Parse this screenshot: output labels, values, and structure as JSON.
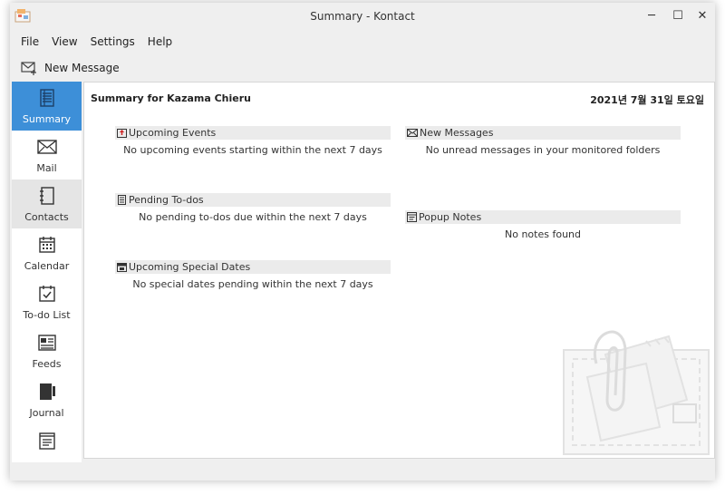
{
  "window": {
    "title": "Summary - Kontact",
    "controls": {
      "minimize": "─",
      "maximize": "☐",
      "close": "✕"
    }
  },
  "menu": [
    "File",
    "View",
    "Settings",
    "Help"
  ],
  "toolbar": {
    "new_message": "New Message"
  },
  "sidebar": {
    "items": [
      {
        "label": "Summary",
        "icon": "summary-icon",
        "active": true
      },
      {
        "label": "Mail",
        "icon": "mail-icon"
      },
      {
        "label": "Contacts",
        "icon": "contacts-icon"
      },
      {
        "label": "Calendar",
        "icon": "calendar-icon"
      },
      {
        "label": "To-do List",
        "icon": "todo-icon"
      },
      {
        "label": "Feeds",
        "icon": "feeds-icon"
      },
      {
        "label": "Journal",
        "icon": "journal-icon"
      },
      {
        "label": "",
        "icon": "notes-icon"
      }
    ]
  },
  "summary": {
    "heading": "Summary for Kazama Chieru",
    "date": "2021년 7월 31일 토요일",
    "sections": {
      "upcoming_events": {
        "title": "Upcoming Events",
        "text": "No upcoming events starting within the next 7 days"
      },
      "pending_todos": {
        "title": "Pending To-dos",
        "text": "No pending to-dos due within the next 7 days"
      },
      "special_dates": {
        "title": "Upcoming Special Dates",
        "text": "No special dates pending within the next 7 days"
      },
      "new_messages": {
        "title": "New Messages",
        "text": "No unread messages in your monitored folders"
      },
      "popup_notes": {
        "title": "Popup Notes",
        "text": "No notes found"
      }
    }
  },
  "colors": {
    "accent": "#3d8fd8",
    "section_bg": "#ebebeb",
    "window_bg": "#efefef"
  }
}
